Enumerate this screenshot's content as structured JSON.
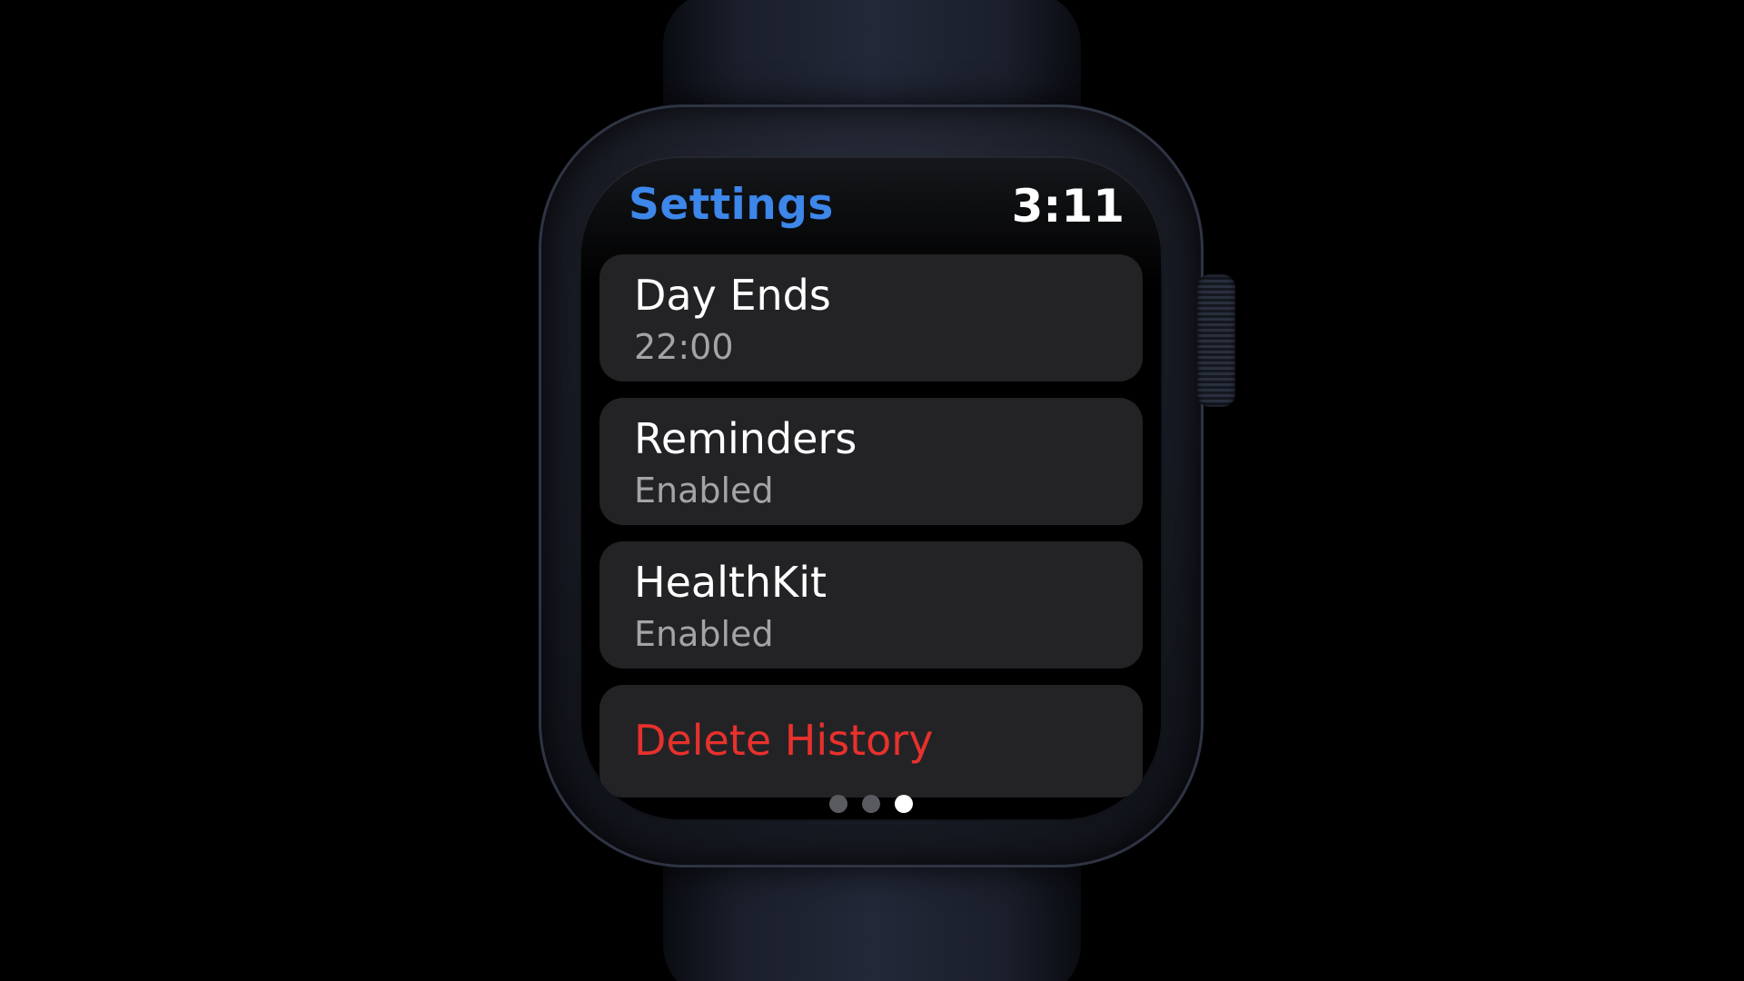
{
  "header": {
    "title": "Settings",
    "time": "3:11"
  },
  "settings_list": [
    {
      "title": "Day Ends",
      "value": "22:00"
    },
    {
      "title": "Reminders",
      "value": "Enabled"
    },
    {
      "title": "HealthKit",
      "value": "Enabled"
    }
  ],
  "delete_action": {
    "label": "Delete History"
  },
  "pagination": {
    "total_pages": 3,
    "current_page": 3
  },
  "colors": {
    "title_accent": "#3d86ea",
    "destructive": "#e8312c",
    "cell_background": "#232326",
    "secondary_text": "#a3a3a8"
  }
}
